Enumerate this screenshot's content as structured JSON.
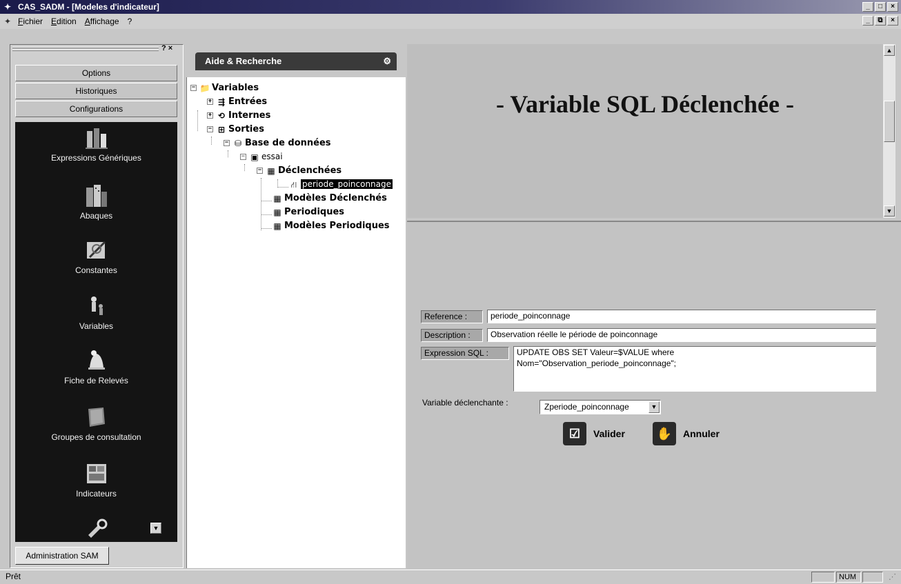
{
  "window": {
    "title": "CAS_SADM - [Modeles d'indicateur]",
    "buttons": [
      "_",
      "□",
      "×"
    ],
    "mdi_buttons": [
      "_",
      "⧉",
      "×"
    ]
  },
  "menubar": {
    "items": [
      "Fichier",
      "Edition",
      "Affichage",
      "?"
    ]
  },
  "left_panel": {
    "controls": "? ×",
    "groups": [
      "Options",
      "Historiques",
      "Configurations"
    ],
    "items": [
      {
        "label": "Expressions Génériques",
        "icon": "chart-building-icon"
      },
      {
        "label": "Abaques",
        "icon": "city-icon"
      },
      {
        "label": "Constantes",
        "icon": "pencil-paper-icon"
      },
      {
        "label": "Variables",
        "icon": "figures-icon"
      },
      {
        "label": "Fiche de Relevés",
        "icon": "bell-icon"
      },
      {
        "label": "Groupes de consultation",
        "icon": "book-icon"
      },
      {
        "label": "Indicateurs",
        "icon": "gauge-board-icon"
      },
      {
        "label": "",
        "icon": "tools-icon"
      }
    ],
    "tab": "Administration SAM"
  },
  "tree_panel": {
    "header": "Aide & Recherche",
    "nodes": {
      "variables": "Variables",
      "entrees": "Entrées",
      "internes": "Internes",
      "sorties": "Sorties",
      "base": "Base de données",
      "essai": "essai",
      "declenchees": "Déclenchées",
      "selected": "periode_poinconnage",
      "modeles_declenches": "Modèles Déclenchés",
      "periodiques": "Periodiques",
      "modeles_periodiques": "Modèles Periodiques"
    }
  },
  "form": {
    "title": "- Variable SQL Déclenchée -",
    "reference_label": "Reference :",
    "reference_value": "periode_poinconnage",
    "description_label": "Description :",
    "description_value": "Observation réelle le période de poinconnage",
    "expression_label": "Expression SQL :",
    "expression_line1": "UPDATE OBS SET Valeur=$VALUE  where",
    "expression_line2": "Nom=\"Observation_periode_poinconnage\";",
    "trigger_label": "Variable déclenchante :",
    "trigger_value": "Zperiode_poinconnage",
    "valider": "Valider",
    "annuler": "Annuler"
  },
  "statusbar": {
    "text": "Prêt",
    "num": "NUM"
  }
}
